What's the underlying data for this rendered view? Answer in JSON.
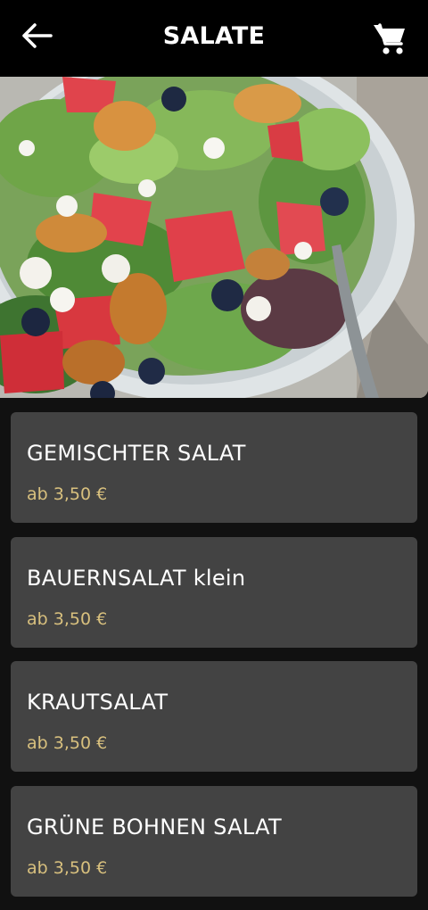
{
  "header": {
    "title": "SALATE",
    "back_icon": "arrow-left-icon",
    "cart_icon": "shopping-cart-icon"
  },
  "hero": {
    "image": "salad-bowl-photo"
  },
  "colors": {
    "background": "#111111",
    "header": "#000000",
    "card": "#434343",
    "price": "#d8c07e",
    "text": "#ffffff"
  },
  "products": [
    {
      "name": "GEMISCHTER SALAT",
      "price": "ab 3,50 €"
    },
    {
      "name": "BAUERNSALAT klein",
      "price": "ab 3,50 €"
    },
    {
      "name": "KRAUTSALAT",
      "price": "ab 3,50 €"
    },
    {
      "name": "GRÜNE BOHNEN SALAT",
      "price": "ab 3,50 €"
    }
  ]
}
